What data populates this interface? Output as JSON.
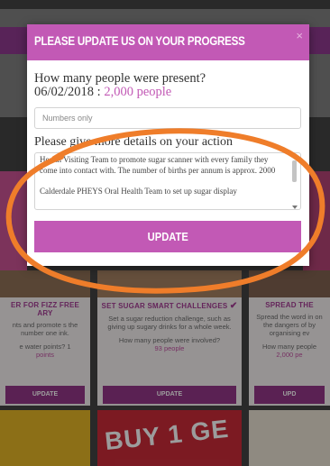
{
  "modal": {
    "title": "PLEASE UPDATE US ON YOUR PROGRESS",
    "close_symbol": "×",
    "question": "How many people were present?",
    "answer_date": "06/02/2018 : ",
    "answer_people": "2,000 people",
    "numbers_placeholder": "Numbers only",
    "details_label": "Please give more details on your action",
    "details_text": "Health Visiting Team to promote sugar scanner with every family they come into contact with. The number of births per annum is approx. 2000\n\nCalderdale PHEYS Oral Health Team to set up sugar display",
    "update_label": "UPDATE"
  },
  "background": {
    "cards": [
      {
        "title": "ER FOR FIZZ FREE ARY",
        "desc": "nts and promote s the number one ink.",
        "question": "e water points? 1",
        "answer": "points",
        "button": "UPDATE"
      },
      {
        "title": "SET SUGAR SMART CHALLENGES",
        "desc": "Set a sugar reduction challenge, such as giving up sugary drinks for a whole week.",
        "question": "How many people were involved?",
        "answer": "93 people",
        "button": "UPDATE"
      },
      {
        "title": "SPREAD THE",
        "desc": "Spread the word in on the dangers of by organising ev",
        "question": "How many people",
        "answer": "2,000 pe",
        "button": "UPD"
      }
    ],
    "banner_text": "BUY 1 GE"
  },
  "colors": {
    "accent": "#c259b5",
    "button_dark": "#8e2b82",
    "annotation": "#ef7d2a"
  }
}
